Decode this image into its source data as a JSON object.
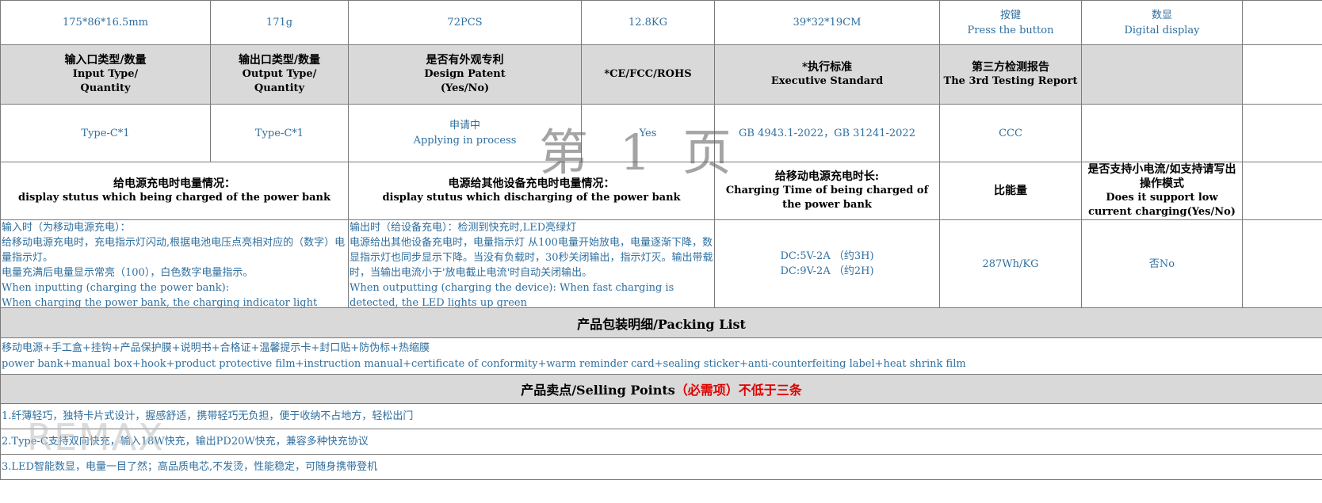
{
  "row1": [
    "175*86*16.5mm",
    "171g",
    "72PCS",
    "12.8KG",
    "39*32*19CM"
  ],
  "row1_button": {
    "zh": "按键",
    "en": "Press the button"
  },
  "row1_display": {
    "zh": "数显",
    "en": "Digital display"
  },
  "header2": {
    "input": {
      "zh": "输入口类型/数量",
      "en1": "Input Type/",
      "en2": "Quantity"
    },
    "output": {
      "zh": "输出口类型/数量",
      "en1": "Output Type/",
      "en2": "Quantity"
    },
    "patent": {
      "zh": "是否有外观专利",
      "en1": "Design Patent",
      "en2": "(Yes/No)"
    },
    "ce": "*CE/FCC/ROHS",
    "standard": {
      "zh": "*执行标准",
      "en": "Executive Standard"
    },
    "report": {
      "zh": "第三方检测报告",
      "en": "The 3rd Testing Report"
    }
  },
  "row3": {
    "input": "Type-C*1",
    "output": "Type-C*1",
    "patent_zh": "申请中",
    "patent_en": "Applying in process",
    "ce": "Yes",
    "standard": "GB 4943.1-2022，GB 31241-2022",
    "report": "CCC"
  },
  "header4": {
    "charging": {
      "zh": "给电源充电时电量情况：",
      "en": "display stutus which being charged of the power bank"
    },
    "discharging": {
      "zh": "电源给其他设备充电时电量情况：",
      "en": "display stutus which discharging of the power bank"
    },
    "time": {
      "zh": "给移动电源充电时长:",
      "en": "Charging Time of being charged of the power bank"
    },
    "energy": "比能量",
    "lowcurrent": {
      "zh": "是否支持小电流/如支持请写出操作模式",
      "en": "Does it support low current charging(Yes/No)"
    }
  },
  "row5": {
    "charging": [
      "输入时（为移动电源充电）：",
      "给移动电源充电时，充电指示灯闪动,根据电池电压点亮相对应的（数字）电量指示灯。",
      "电量充满后电量显示常亮（100），白色数字电量指示。",
      "When inputting (charging the power bank):",
      "When charging the power bank, the charging indicator light flashes, and the"
    ],
    "discharging": [
      "输出时（给设备充电）：检测到快充时,LED亮绿灯",
      "电源给出其他设备充电时，电量指示灯 从100电量开始放电，电量逐渐下降，数显指示灯也同步显示下降。当没有负载时，30秒关闭输出，指示灯灭。输出带载时，当输出电流小于'放电截止电流'时自动关闭输出。",
      "When outputting (charging the device): When fast charging is detected, the LED lights up green"
    ],
    "time": [
      "DC:5V-2A （约3H)",
      "DC:9V-2A （约2H)"
    ],
    "energy": "287Wh/KG",
    "lowcurrent": "否No"
  },
  "packing": {
    "title": "产品包装明细/Packing List",
    "zh": "移动电源+手工盒+挂钩+产品保护膜+说明书+合格证+温馨提示卡+封口贴+防伪标+热缩膜",
    "en": "power bank+manual box+hook+product protective film+instruction manual+certificate of conformity+warm reminder card+sealing sticker+anti-counterfeiting label+heat shrink film"
  },
  "selling": {
    "title": "产品卖点/Selling Points",
    "required": "（必需项）不低于三条",
    "points": [
      "1.纤薄轻巧，独特卡片式设计，握感舒适，携带轻巧无负担，便于收纳不占地方，轻松出门",
      "2.Type-C支持双向快充，输入18W快充，输出PD20W快充，兼容多种快充协议",
      "3.LED智能数显，电量一目了然；高品质电芯,不发烫，性能稳定，可随身携带登机"
    ]
  },
  "watermark": "第 1 页",
  "logo": "REMAX"
}
